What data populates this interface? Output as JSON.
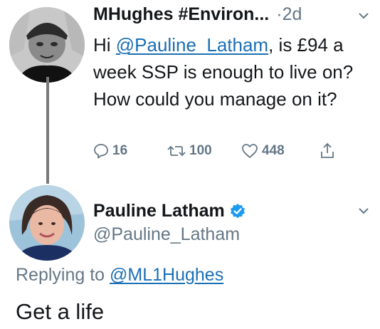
{
  "tweet": {
    "author_name": "MHughes #Environ...",
    "time": "·2d",
    "text_line1_pre": "Hi ",
    "mention": "@Pauline_Latham",
    "text_line1_post": ", is £94",
    "text_rest": "a week SSP is enough to live on? How could you manage on it?",
    "stats": {
      "replies": "16",
      "retweets": "100",
      "likes": "448"
    }
  },
  "reply": {
    "author_name": "Pauline Latham",
    "handle": "@Pauline_Latham",
    "replying_prefix": "Replying to ",
    "replying_to": "@ML1Hughes",
    "text": "Get a life"
  },
  "icons": {
    "reply": "comment-icon",
    "retweet": "retweet-icon",
    "like": "heart-icon",
    "share": "share-icon",
    "verified": "verified-badge-icon",
    "menu": "chevron-down-icon"
  },
  "colors": {
    "link": "#1b6fb5",
    "muted": "#657786",
    "verified": "#1d9bf0",
    "text": "#14171a"
  }
}
